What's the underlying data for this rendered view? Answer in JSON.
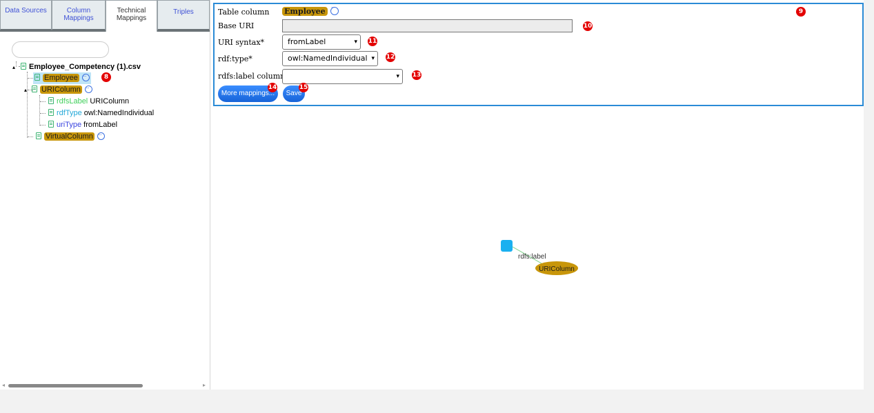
{
  "tabs": {
    "data_sources": "Data Sources",
    "column_mappings": "Column Mappings",
    "technical_mappings": "Technical Mappings",
    "triples": "Triples"
  },
  "tree": {
    "search_placeholder": "",
    "root": "Employee_Competency (1).csv",
    "items": [
      {
        "name": "Employee"
      },
      {
        "name": "URIColumn",
        "children": [
          {
            "key": "rdfsLabel",
            "value": "URIColumn",
            "key_color": "#3fcf5a"
          },
          {
            "key": "rdfType",
            "value": "owl:NamedIndividual",
            "key_color": "#22a8d8"
          },
          {
            "key": "uriType",
            "value": "fromLabel",
            "key_color": "#3a45e0"
          }
        ]
      },
      {
        "name": "VirtualColumn"
      }
    ]
  },
  "form": {
    "table_column_label": "Table column",
    "table_column_value": "Employee",
    "base_uri_label": "Base URI",
    "base_uri_value": "",
    "uri_syntax_label": "URI syntax*",
    "uri_syntax_value": "fromLabel",
    "rdf_type_label": "rdf:type*",
    "rdf_type_value": "owl:NamedIndividual",
    "rdfs_label_label": "rdfs:label column",
    "rdfs_label_value": "",
    "more_mappings_button": "More mappings...",
    "save_button": "Save"
  },
  "badges": [
    "8",
    "9",
    "10",
    "11",
    "12",
    "13",
    "14",
    "15"
  ],
  "graph": {
    "edge_label": "rdfs:label",
    "target_node_label": "URIColumn",
    "source_node_color": "#1ab0f0",
    "target_node_color": "#c8960a"
  },
  "colors": {
    "accent": "#2a8bd6",
    "pill": "#c8960a",
    "badge": "#e30000"
  }
}
